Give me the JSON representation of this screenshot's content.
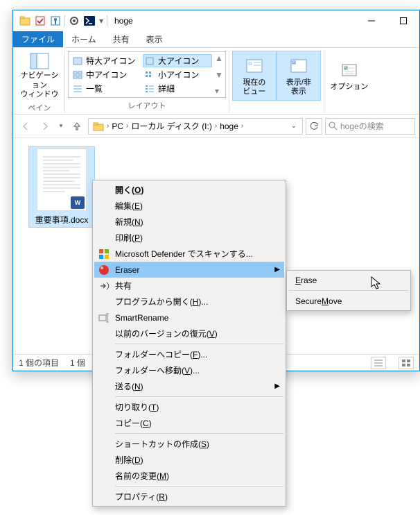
{
  "titlebar": {
    "title": "hoge"
  },
  "menu": {
    "file": "ファイル",
    "home": "ホーム",
    "share": "共有",
    "view": "表示"
  },
  "ribbon": {
    "pane_group": "ペイン",
    "navpane": "ナビゲーション\nウィンドウ",
    "layout_group": "レイアウト",
    "items": {
      "extra_large": "特大アイコン",
      "large": "大アイコン",
      "medium": "中アイコン",
      "small": "小アイコン",
      "list": "一覧",
      "details": "詳細"
    },
    "current_view": "現在の\nビュー",
    "show_hide": "表示/非\n表示",
    "options": "オプション"
  },
  "breadcrumb": {
    "pc": "PC",
    "disk": "ローカル ディスク (I:)",
    "folder": "hoge"
  },
  "search": {
    "placeholder": "hogeの検索"
  },
  "file": {
    "name": "重要事項.docx",
    "badge": "W"
  },
  "status": {
    "count": "1 個の項目",
    "sel": "1 個"
  },
  "ctx": {
    "open": "開く(O)",
    "edit": "編集(E)",
    "new": "新規(N)",
    "print": "印刷(P)",
    "defender": "Microsoft Defender でスキャンする...",
    "eraser": "Eraser",
    "share": "共有",
    "openwith": "プログラムから開く(H)...",
    "smartrename": "SmartRename",
    "prevver": "以前のバージョンの復元(V)",
    "copyto": "フォルダーへコピー(F)...",
    "moveto": "フォルダーへ移動(V)...",
    "sendto": "送る(N)",
    "cut": "切り取り(T)",
    "copy": "コピー(C)",
    "shortcut": "ショートカットの作成(S)",
    "delete": "削除(D)",
    "rename": "名前の変更(M)",
    "props": "プロパティ(R)"
  },
  "sub": {
    "erase": "Erase",
    "secmove": "Secure Move"
  }
}
